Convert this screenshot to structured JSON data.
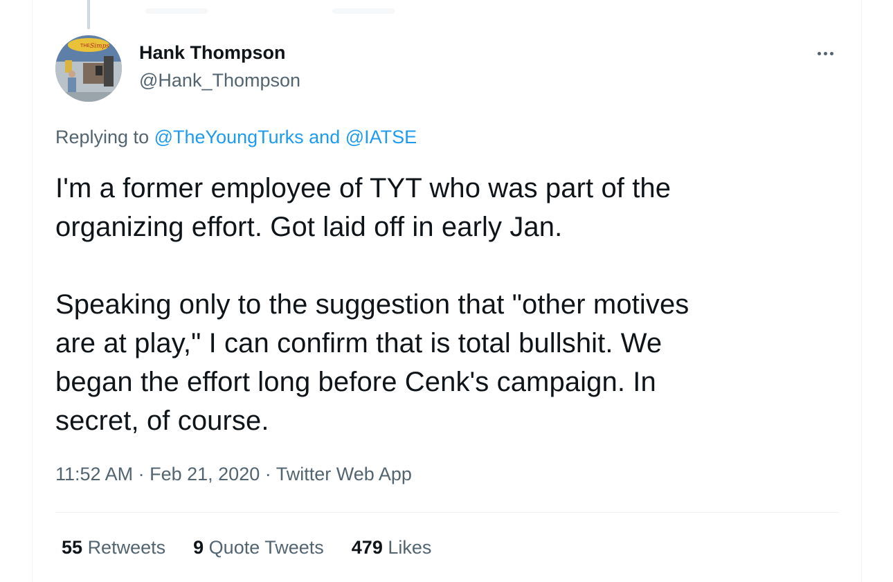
{
  "tweet": {
    "author": {
      "display_name": "Hank Thompson",
      "handle": "@Hank_Thompson"
    },
    "reply_context": {
      "prefix": "Replying to",
      "mention_1": "@TheYoungTurks",
      "conjunction": "and",
      "mention_2": "@IATSE"
    },
    "text": {
      "line1": "I'm a former employee of TYT who was part of the",
      "line2": "organizing effort. Got laid off in early Jan.",
      "line3": "Speaking only to the suggestion that \"other motives",
      "line4": "are at play,\" I can confirm that is total bullshit. We",
      "line5": "began the effort long before Cenk's campaign. In",
      "line6": "secret, of course."
    },
    "meta": {
      "time": "11:52 AM",
      "date": "Feb 21, 2020",
      "source": "Twitter Web App",
      "separator": "·"
    },
    "stats": {
      "retweets_count": "55",
      "retweets_label": "Retweets",
      "quotes_count": "9",
      "quotes_label": "Quote Tweets",
      "likes_count": "479",
      "likes_label": "Likes"
    }
  },
  "colors": {
    "text_primary": "#0f1419",
    "text_secondary": "#536471",
    "link": "#1d9bf0",
    "divider": "#eff3f4"
  },
  "icons": {
    "more": "more-horizontal-icon"
  }
}
